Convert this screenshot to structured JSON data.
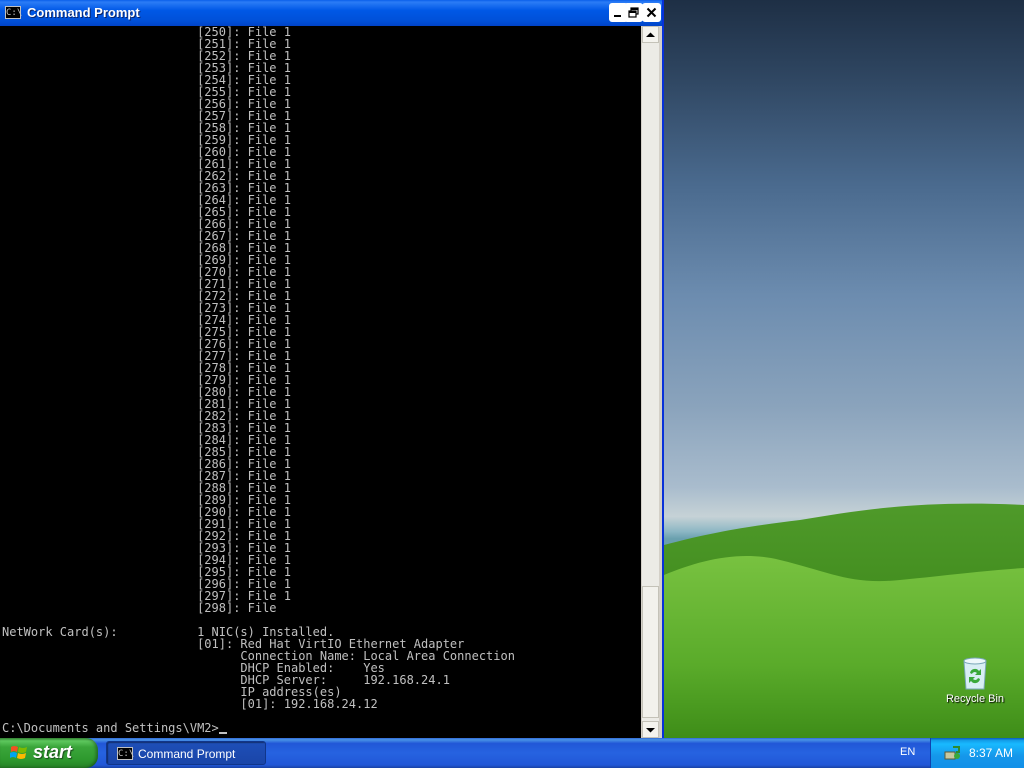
{
  "window": {
    "title": "Command Prompt",
    "icon_text": "C:\\"
  },
  "console": {
    "file_entries": [
      {
        "index": "250",
        "text": "File 1"
      },
      {
        "index": "251",
        "text": "File 1"
      },
      {
        "index": "252",
        "text": "File 1"
      },
      {
        "index": "253",
        "text": "File 1"
      },
      {
        "index": "254",
        "text": "File 1"
      },
      {
        "index": "255",
        "text": "File 1"
      },
      {
        "index": "256",
        "text": "File 1"
      },
      {
        "index": "257",
        "text": "File 1"
      },
      {
        "index": "258",
        "text": "File 1"
      },
      {
        "index": "259",
        "text": "File 1"
      },
      {
        "index": "260",
        "text": "File 1"
      },
      {
        "index": "261",
        "text": "File 1"
      },
      {
        "index": "262",
        "text": "File 1"
      },
      {
        "index": "263",
        "text": "File 1"
      },
      {
        "index": "264",
        "text": "File 1"
      },
      {
        "index": "265",
        "text": "File 1"
      },
      {
        "index": "266",
        "text": "File 1"
      },
      {
        "index": "267",
        "text": "File 1"
      },
      {
        "index": "268",
        "text": "File 1"
      },
      {
        "index": "269",
        "text": "File 1"
      },
      {
        "index": "270",
        "text": "File 1"
      },
      {
        "index": "271",
        "text": "File 1"
      },
      {
        "index": "272",
        "text": "File 1"
      },
      {
        "index": "273",
        "text": "File 1"
      },
      {
        "index": "274",
        "text": "File 1"
      },
      {
        "index": "275",
        "text": "File 1"
      },
      {
        "index": "276",
        "text": "File 1"
      },
      {
        "index": "277",
        "text": "File 1"
      },
      {
        "index": "278",
        "text": "File 1"
      },
      {
        "index": "279",
        "text": "File 1"
      },
      {
        "index": "280",
        "text": "File 1"
      },
      {
        "index": "281",
        "text": "File 1"
      },
      {
        "index": "282",
        "text": "File 1"
      },
      {
        "index": "283",
        "text": "File 1"
      },
      {
        "index": "284",
        "text": "File 1"
      },
      {
        "index": "285",
        "text": "File 1"
      },
      {
        "index": "286",
        "text": "File 1"
      },
      {
        "index": "287",
        "text": "File 1"
      },
      {
        "index": "288",
        "text": "File 1"
      },
      {
        "index": "289",
        "text": "File 1"
      },
      {
        "index": "290",
        "text": "File 1"
      },
      {
        "index": "291",
        "text": "File 1"
      },
      {
        "index": "292",
        "text": "File 1"
      },
      {
        "index": "293",
        "text": "File 1"
      },
      {
        "index": "294",
        "text": "File 1"
      },
      {
        "index": "295",
        "text": "File 1"
      },
      {
        "index": "296",
        "text": "File 1"
      },
      {
        "index": "297",
        "text": "File 1"
      },
      {
        "index": "298",
        "text": "File"
      }
    ],
    "network": {
      "label": "NetWork Card(s):",
      "summary": "1 NIC(s) Installed.",
      "adapter_index": "01",
      "adapter_name": "Red Hat VirtIO Ethernet Adapter",
      "connection_name_label": "Connection Name:",
      "connection_name": "Local Area Connection",
      "dhcp_enabled_label": "DHCP Enabled:",
      "dhcp_enabled": "Yes",
      "dhcp_server_label": "DHCP Server:",
      "dhcp_server": "192.168.24.1",
      "ip_label": "IP address(es)",
      "ip_index": "01",
      "ip": "192.168.24.12"
    },
    "prompt": "C:\\Documents and Settings\\VM2>"
  },
  "desktop": {
    "recycle_bin_label": "Recycle Bin"
  },
  "taskbar": {
    "start_label": "start",
    "task_item_label": "Command Prompt",
    "language": "EN",
    "clock": "8:37 AM"
  }
}
